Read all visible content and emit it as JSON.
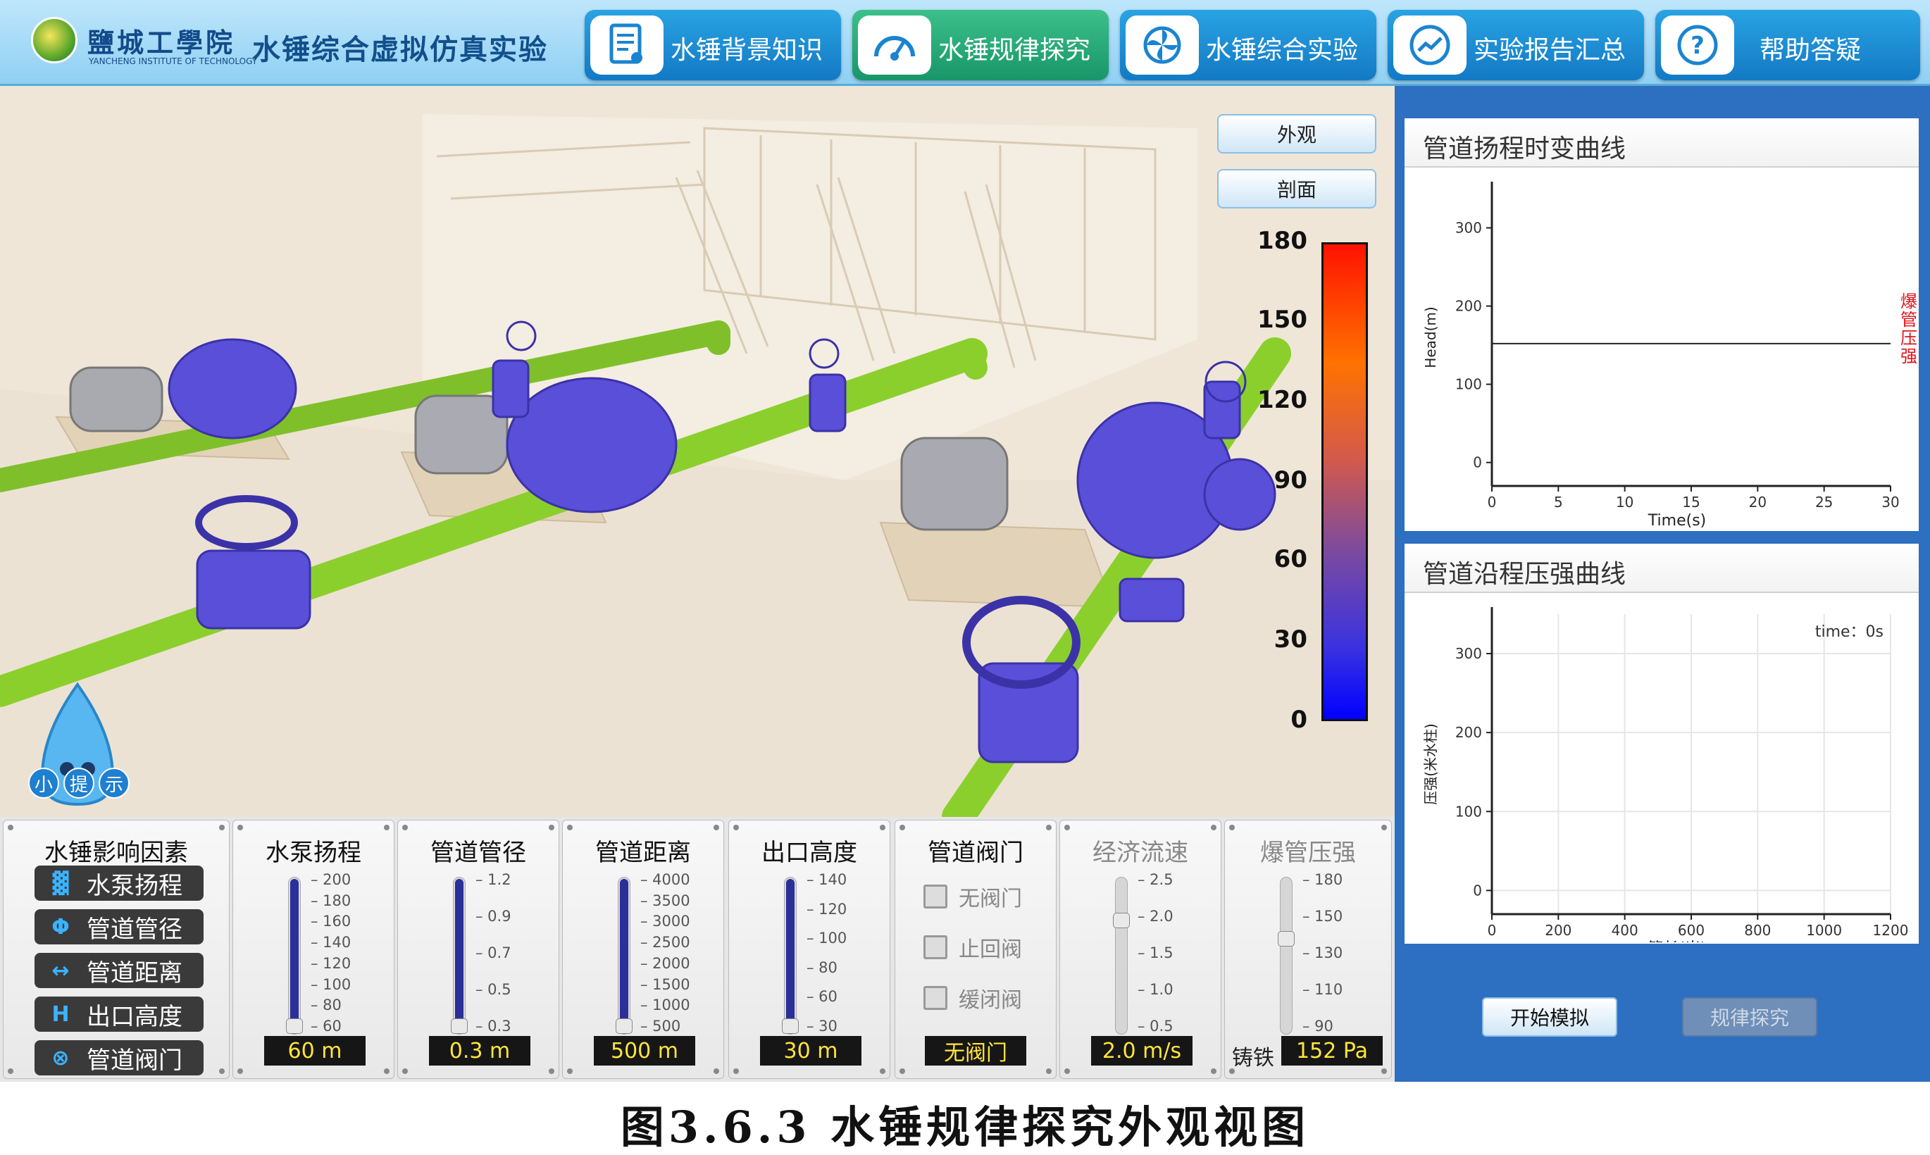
{
  "header": {
    "school_name": "鹽城工學院",
    "school_en": "YANCHENG INSTITUTE OF TECHNOLOGY",
    "app_title": "水锤综合虚拟仿真实验"
  },
  "tabs": [
    {
      "label": "水锤背景知识",
      "icon": "document-icon"
    },
    {
      "label": "水锤规律探究",
      "icon": "gauge-icon",
      "active": true
    },
    {
      "label": "水锤综合实验",
      "icon": "fan-icon"
    },
    {
      "label": "实验报告汇总",
      "icon": "line-chart-icon"
    },
    {
      "label": "帮助答疑",
      "icon": "question-icon"
    }
  ],
  "view_buttons": {
    "exterior": "外观",
    "section": "剖面"
  },
  "color_scale": {
    "labels": [
      "180",
      "150",
      "120",
      "90",
      "60",
      "30",
      "0"
    ],
    "colors": [
      "#ff1a00",
      "#ff7a00",
      "#e05a3a",
      "#9a4a8a",
      "#5a3ac8",
      "#2a2af0",
      "#0000ff"
    ]
  },
  "hint": {
    "label": "小提示",
    "chars": [
      "小",
      "提",
      "示"
    ]
  },
  "factors": {
    "title": "水锤影响因素",
    "items": [
      {
        "label": "水泵扬程",
        "icon": "pump-head-icon",
        "glyph": "▓"
      },
      {
        "label": "管道管径",
        "icon": "diameter-icon",
        "glyph": "Φ"
      },
      {
        "label": "管道距离",
        "icon": "distance-icon",
        "glyph": "↔"
      },
      {
        "label": "出口高度",
        "icon": "height-icon",
        "glyph": "H"
      },
      {
        "label": "管道阀门",
        "icon": "valve-icon",
        "glyph": "⊗"
      }
    ]
  },
  "sliders": [
    {
      "title": "水泵扬程",
      "ticks": [
        "200",
        "180",
        "160",
        "140",
        "120",
        "100",
        "80",
        "60"
      ],
      "value": "60 m",
      "level": 0.0,
      "enabled": true
    },
    {
      "title": "管道管径",
      "ticks": [
        "1.2",
        "0.9",
        "0.7",
        "0.5",
        "0.3"
      ],
      "value": "0.3 m",
      "level": 0.0,
      "enabled": true
    },
    {
      "title": "管道距离",
      "ticks": [
        "4000",
        "3500",
        "3000",
        "2500",
        "2000",
        "1500",
        "1000",
        "500"
      ],
      "value": "500 m",
      "level": 0.0,
      "enabled": true
    },
    {
      "title": "出口高度",
      "ticks": [
        "140",
        "120",
        "100",
        "80",
        "60",
        "30"
      ],
      "value": "30 m",
      "level": 0.0,
      "enabled": true
    }
  ],
  "valve": {
    "title": "管道阀门",
    "options": [
      "无阀门",
      "止回阀",
      "缓闭阀"
    ],
    "value": "无阀门"
  },
  "flow_speed": {
    "title": "经济流速",
    "ticks": [
      "2.5",
      "2.0",
      "1.5",
      "1.0",
      "0.5"
    ],
    "value": "2.0 m/s",
    "level": 0.75
  },
  "burst": {
    "title": "爆管压强",
    "ticks": [
      "180",
      "150",
      "130",
      "110",
      "90"
    ],
    "material": "铸铁",
    "value": "152 Pa",
    "level": 0.62
  },
  "charts": {
    "head": {
      "title": "管道扬程时变曲线",
      "ylabel": "Head(m)",
      "xlabel": "Time(s)",
      "yticks": [
        "300",
        "200",
        "100",
        "0"
      ],
      "xticks": [
        "0",
        "5",
        "10",
        "15",
        "20",
        "25",
        "30"
      ],
      "burst_label": "爆管压强",
      "burst_chars": [
        "爆",
        "管",
        "压",
        "强"
      ]
    },
    "pressure": {
      "title": "管道沿程压强曲线",
      "ylabel": "压强(米水柱)",
      "xlabel": "管长(米)",
      "yticks": [
        "300",
        "200",
        "100",
        "0"
      ],
      "xticks": [
        "0",
        "200",
        "400",
        "600",
        "800",
        "1000",
        "1200"
      ],
      "time_text": "time：0s"
    }
  },
  "chart_data": [
    {
      "type": "line",
      "title": "管道扬程时变曲线",
      "xlabel": "Time(s)",
      "ylabel": "Head(m)",
      "xlim": [
        0,
        30
      ],
      "ylim": [
        -30,
        350
      ],
      "series": [
        {
          "name": "爆管压强",
          "x": [
            0,
            30
          ],
          "y": [
            152,
            152
          ]
        }
      ]
    },
    {
      "type": "line",
      "title": "管道沿程压强曲线",
      "xlabel": "管长(米)",
      "ylabel": "压强(米水柱)",
      "xlim": [
        0,
        1200
      ],
      "ylim": [
        -30,
        350
      ],
      "grid": true,
      "series": []
    }
  ],
  "actions": {
    "start": "开始模拟",
    "explore": "规律探究"
  },
  "caption": "图3.6.3 水锤规律探究外观视图"
}
